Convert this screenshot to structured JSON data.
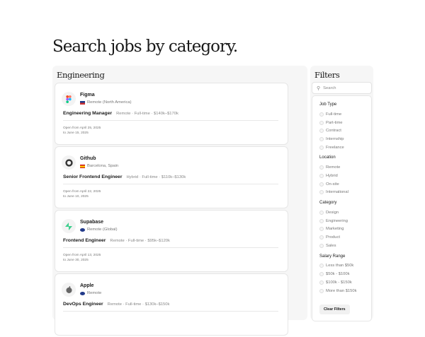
{
  "page_title": "Search jobs by category.",
  "category_title": "Engineering",
  "jobs": [
    {
      "company": "Figma",
      "location": "Remote (North America)",
      "title": "Engineering Manager",
      "work_mode": "Remote",
      "type": "Full-time",
      "salary": "$140k–$170k",
      "open_from": "Open from April 25, 2025",
      "open_to": "to June 15, 2025"
    },
    {
      "company": "Github",
      "location": "Barcelona, Spain",
      "title": "Senior Frontend Engineer",
      "work_mode": "Hybrid",
      "type": "Full-time",
      "salary": "$110k–$130k",
      "open_from": "Open from April 22, 2025",
      "open_to": "to June 10, 2025"
    },
    {
      "company": "Supabase",
      "location": "Remote (Global)",
      "title": "Frontend Engineer",
      "work_mode": "Remote",
      "type": "Full-time",
      "salary": "$95k–$120k",
      "open_from": "Open from April 13, 2025",
      "open_to": "to June 30, 2025"
    },
    {
      "company": "Apple",
      "location": "Remote",
      "title": "DevOps Engineer",
      "work_mode": "Remote",
      "type": "Full-time",
      "salary": "$130k–$150k",
      "open_from": "",
      "open_to": ""
    }
  ],
  "filters": {
    "title": "Filters",
    "search_placeholder": "Search",
    "groups": [
      {
        "label": "Job Type",
        "options": [
          "Full-time",
          "Part-time",
          "Contract",
          "Internship",
          "Freelance"
        ]
      },
      {
        "label": "Location",
        "options": [
          "Remote",
          "Hybrid",
          "On-site",
          "International"
        ]
      },
      {
        "label": "Category",
        "options": [
          "Design",
          "Engineering",
          "Marketing",
          "Product",
          "Sales"
        ]
      },
      {
        "label": "Salary Range",
        "options": [
          "Less than $50k",
          "$50k - $100k",
          "$100k - $150k",
          "More than $150k"
        ]
      }
    ],
    "clear_label": "Clear Filters"
  },
  "sep": "·"
}
